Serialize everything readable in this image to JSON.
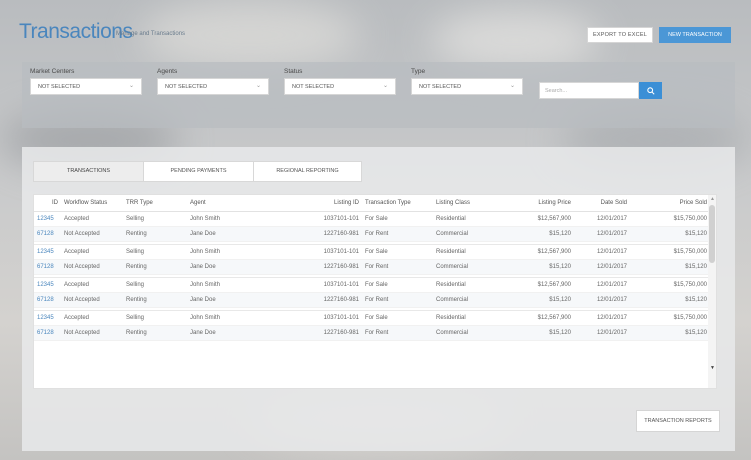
{
  "header": {
    "title": "Transactions",
    "subtitle": "Manage and Transactions",
    "export_label": "EXPORT TO EXCEL",
    "new_label": "NEW TRANSACTION"
  },
  "filters": [
    {
      "label": "Market Centers",
      "value": "NOT SELECTED"
    },
    {
      "label": "Agents",
      "value": "NOT SELECTED"
    },
    {
      "label": "Status",
      "value": "NOT SELECTED"
    },
    {
      "label": "Type",
      "value": "NOT SELECTED"
    }
  ],
  "search": {
    "placeholder": "Search..."
  },
  "tabs": [
    {
      "label": "TRANSACTIONS",
      "active": true
    },
    {
      "label": "PENDING PAYMENTS",
      "active": false
    },
    {
      "label": "REGIONAL REPORTING",
      "active": false
    }
  ],
  "table": {
    "columns": [
      "ID",
      "Workflow Status",
      "TRR Type",
      "Agent",
      "Listing ID",
      "Transaction Type",
      "Listing Class",
      "Listing Price",
      "Date Sold",
      "Price Sold"
    ],
    "rows": [
      [
        "12345",
        "Accepted",
        "Selling",
        "John Smith",
        "1037101-101",
        "For Sale",
        "Residential",
        "$12,567,900",
        "12/01/2017",
        "$15,750,000"
      ],
      [
        "67128",
        "Not Accepted",
        "Renting",
        "Jane Doe",
        "1227160-981",
        "For Rent",
        "Commercial",
        "$15,120",
        "12/01/2017",
        "$15,120"
      ],
      [
        "12345",
        "Accepted",
        "Selling",
        "John Smith",
        "1037101-101",
        "For Sale",
        "Residential",
        "$12,567,900",
        "12/01/2017",
        "$15,750,000"
      ],
      [
        "67128",
        "Not Accepted",
        "Renting",
        "Jane Doe",
        "1227160-981",
        "For Rent",
        "Commercial",
        "$15,120",
        "12/01/2017",
        "$15,120"
      ],
      [
        "12345",
        "Accepted",
        "Selling",
        "John Smith",
        "1037101-101",
        "For Sale",
        "Residential",
        "$12,567,900",
        "12/01/2017",
        "$15,750,000"
      ],
      [
        "67128",
        "Not Accepted",
        "Renting",
        "Jane Doe",
        "1227160-981",
        "For Rent",
        "Commercial",
        "$15,120",
        "12/01/2017",
        "$15,120"
      ],
      [
        "12345",
        "Accepted",
        "Selling",
        "John Smith",
        "1037101-101",
        "For Sale",
        "Residential",
        "$12,567,900",
        "12/01/2017",
        "$15,750,000"
      ],
      [
        "67128",
        "Not Accepted",
        "Renting",
        "Jane Doe",
        "1227160-981",
        "For Rent",
        "Commercial",
        "$15,120",
        "12/01/2017",
        "$15,120"
      ]
    ]
  },
  "reports_label": "TRANSACTION REPORTS",
  "icons": {
    "search": "search-icon",
    "dropdown": "chevron-down-icon",
    "scroll_up": "scroll-up-icon",
    "scroll_down": "scroll-down-icon"
  },
  "colors": {
    "accent": "#4b97d6",
    "title": "#4a86bd",
    "id_link": "#4a86bd"
  }
}
